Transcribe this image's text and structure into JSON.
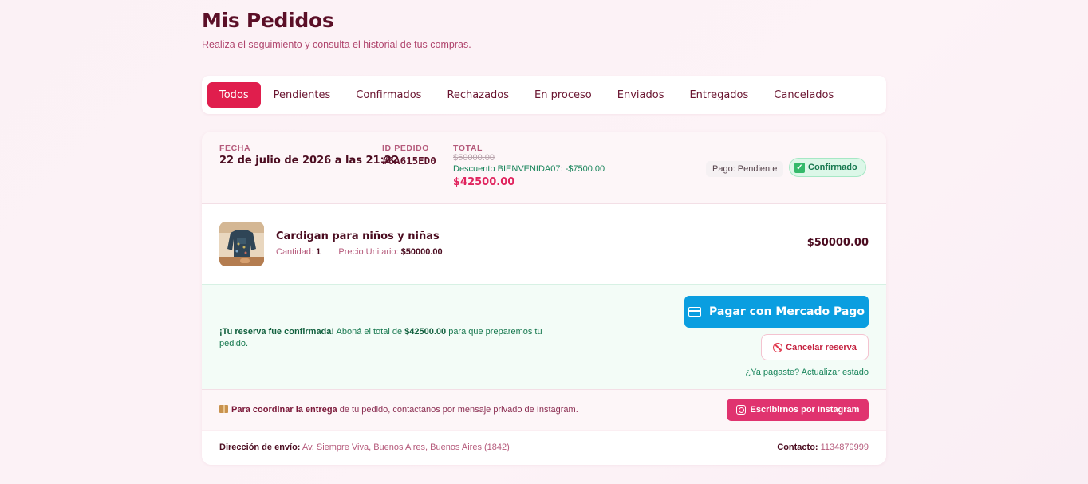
{
  "page": {
    "title": "Mis Pedidos",
    "subtitle": "Realiza el seguimiento y consulta el historial de tus compras."
  },
  "tabs": [
    {
      "label": "Todos",
      "active": true
    },
    {
      "label": "Pendientes",
      "active": false
    },
    {
      "label": "Confirmados",
      "active": false
    },
    {
      "label": "Rechazados",
      "active": false
    },
    {
      "label": "En proceso",
      "active": false
    },
    {
      "label": "Enviados",
      "active": false
    },
    {
      "label": "Entregados",
      "active": false
    },
    {
      "label": "Cancelados",
      "active": false
    }
  ],
  "order": {
    "date_label": "FECHA",
    "date_value": "22 de julio de 2026 a las 21:22",
    "id_label": "ID PEDIDO",
    "id_value": "#6A615ED0",
    "total_label": "TOTAL",
    "total_original": "$50000.00",
    "discount": "Descuento BIENVENIDA07: -$7500.00",
    "total_final": "$42500.00",
    "payment_status": "Pago: Pendiente",
    "status": "Confirmado",
    "status_icon": "check-icon"
  },
  "item": {
    "name": "Cardigan para niños y niñas",
    "quantity_label": "Cantidad:",
    "quantity": "1",
    "unit_price_label": "Precio Unitario:",
    "unit_price": "$50000.00",
    "line_total": "$50000.00"
  },
  "payment": {
    "msg_strong": "¡Tu reserva fue confirmada!",
    "msg_text1": " Aboná el total de ",
    "msg_amount": "$42500.00",
    "msg_text2": " para que preparemos tu pedido.",
    "mp_button": "Pagar con Mercado Pago",
    "cancel_button": "Cancelar reserva",
    "update_link": "¿Ya pagaste? Actualizar estado"
  },
  "delivery": {
    "msg_strong": "Para coordinar la entrega",
    "msg_text": " de tu pedido, contactanos por mensaje privado de Instagram.",
    "instagram_button": "Escribirnos por Instagram",
    "address_label": "Dirección de envío:",
    "address_value": " Av. Siempre Viva, Buenos Aires, Buenos Aires (1842)",
    "contact_label": "Contacto:",
    "contact_value": " 1134879999"
  },
  "colors": {
    "accent": "#e01e4d",
    "mercado_pago": "#0a9ee0",
    "instagram": "#e0336f",
    "success": "#17784f"
  }
}
